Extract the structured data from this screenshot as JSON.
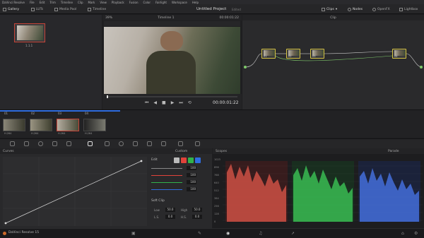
{
  "app": {
    "menu": [
      "DaVinci Resolve",
      "File",
      "Edit",
      "Trim",
      "Timeline",
      "Clip",
      "Mark",
      "View",
      "Playback",
      "Fusion",
      "Color",
      "Fairlight",
      "Workspace",
      "Help"
    ],
    "project_title": "Untitled Project",
    "project_status": "Edited",
    "name": "DaVinci Resolve 15"
  },
  "toolbar": {
    "gallery": "Gallery",
    "luts": "LUTs",
    "media_pool": "Media Pool",
    "timeline": "Timeline",
    "clips": "Clips",
    "nodes": "Nodes",
    "openfx": "OpenFX",
    "lightbox": "Lightbox"
  },
  "gallery": {
    "still_label": "1.1.1"
  },
  "viewer": {
    "zoom": "39%",
    "timeline_name": "Timeline 1",
    "timecode_top": "00:00:01:22",
    "timecode": "00:00:01:22"
  },
  "node_editor": {
    "header": "Clip",
    "nodes": [
      "01",
      "02",
      "03",
      "04"
    ]
  },
  "clips": [
    {
      "num": "01",
      "codec": "H.264"
    },
    {
      "num": "02",
      "codec": "H.264"
    },
    {
      "num": "03",
      "codec": "H.264"
    },
    {
      "num": "04",
      "codec": "H.264"
    }
  ],
  "curves": {
    "title": "Curves",
    "mode": "Custom",
    "edit": "Edit",
    "values": [
      "100",
      "100",
      "100",
      "100"
    ],
    "soft_clip": "Soft Clip",
    "low_label": "Low",
    "low_val": "50.0",
    "high_label": "High",
    "high_val": "50.0",
    "ls_label": "L.S.",
    "ls_val": "0.0",
    "hs_label": "H.S.",
    "hs_val": "0.0"
  },
  "scopes": {
    "title": "Scopes",
    "mode": "Parade",
    "ticks": [
      "1023",
      "896",
      "768",
      "640",
      "512",
      "384",
      "256",
      "128",
      "0"
    ]
  },
  "colors": {
    "accent_red": "#c74438",
    "node_yellow": "#d4c242",
    "red": "#e0433a",
    "green": "#31b34b",
    "blue": "#2f6de0"
  }
}
